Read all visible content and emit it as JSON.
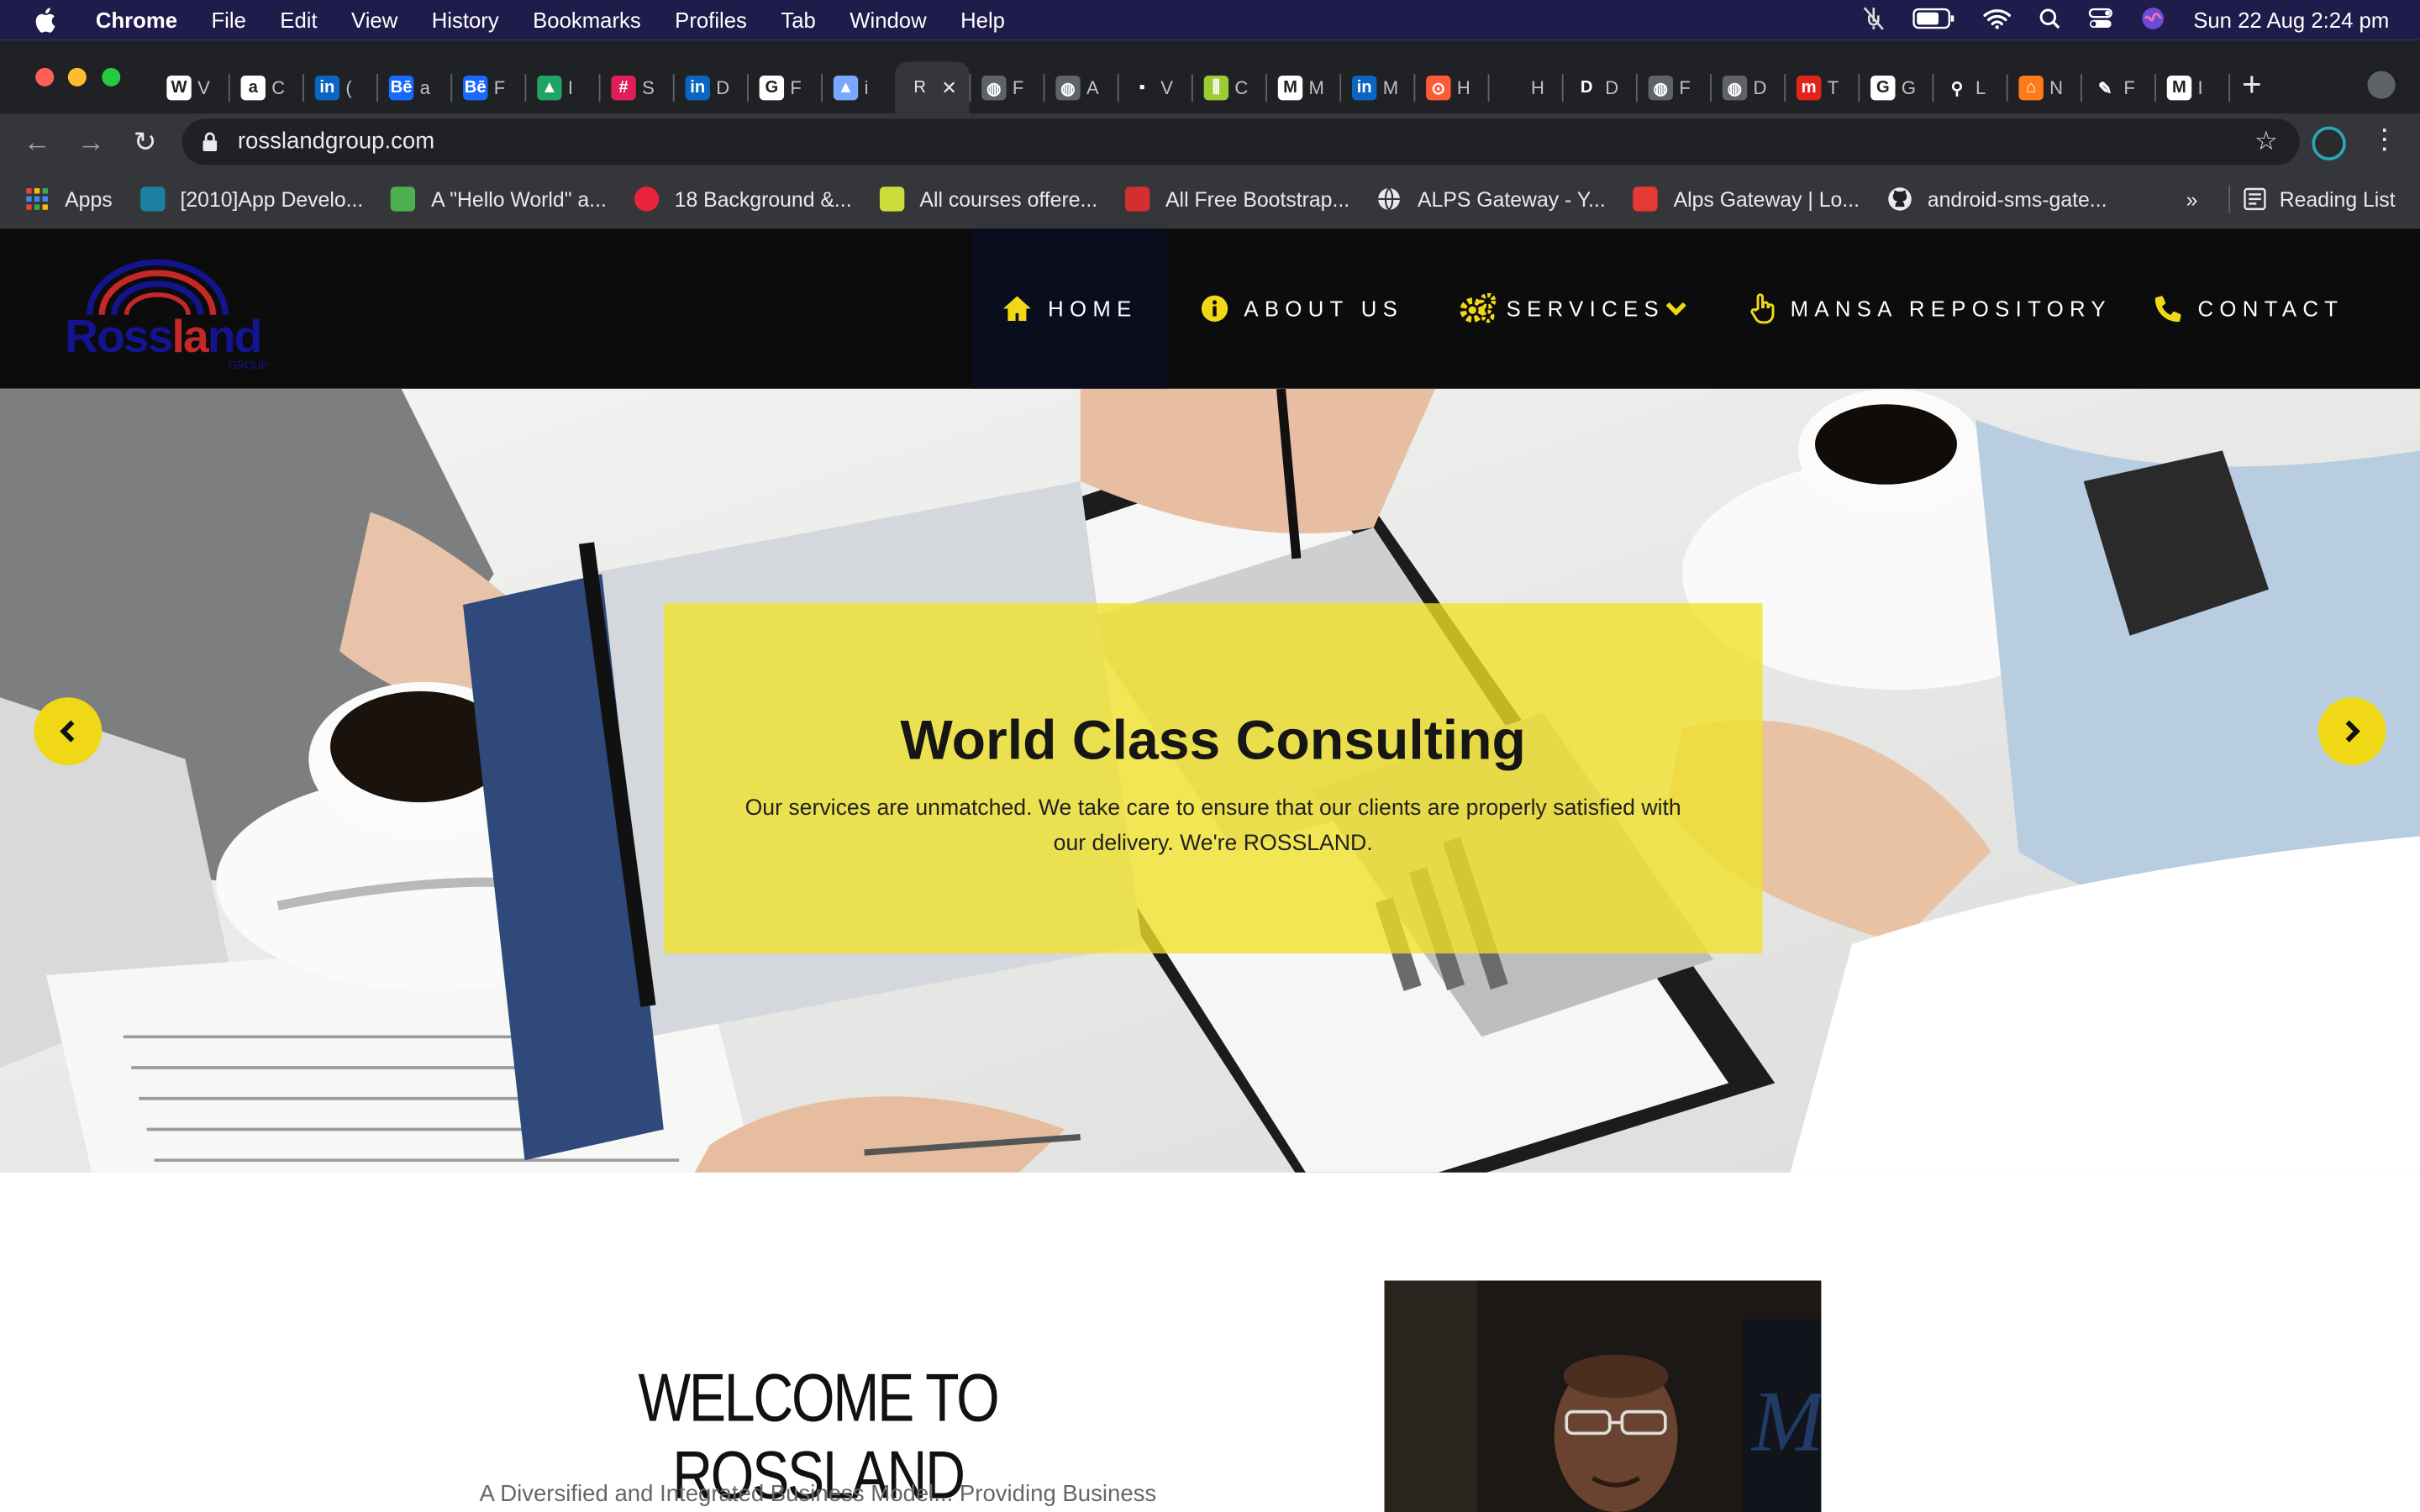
{
  "menubar": {
    "app_name": "Chrome",
    "menus": [
      "File",
      "Edit",
      "View",
      "History",
      "Bookmarks",
      "Profiles",
      "Tab",
      "Window",
      "Help"
    ],
    "clock": "Sun 22 Aug  2:24 pm"
  },
  "tabs": {
    "items": [
      {
        "icon": "wikipedia-icon",
        "glyph": "W",
        "title": "V",
        "color": "#ffffff"
      },
      {
        "icon": "amazon-icon",
        "glyph": "a",
        "title": "C",
        "color": "#ffffff"
      },
      {
        "icon": "linkedin-icon",
        "glyph": "in",
        "title": "(",
        "color": "#0a66c2"
      },
      {
        "icon": "behance-icon",
        "glyph": "Bē",
        "title": "a",
        "color": "#1769ff"
      },
      {
        "icon": "behance-icon",
        "glyph": "Bē",
        "title": "F",
        "color": "#1769ff"
      },
      {
        "icon": "google-drive-icon",
        "glyph": "▲",
        "title": "I",
        "color": "#1fa463"
      },
      {
        "icon": "slack-icon",
        "glyph": "#",
        "title": "S",
        "color": "#e01e5a"
      },
      {
        "icon": "linkedin-icon",
        "glyph": "in",
        "title": "D",
        "color": "#0a66c2"
      },
      {
        "icon": "google-icon",
        "glyph": "G",
        "title": "F",
        "color": "#ffffff"
      },
      {
        "icon": "triangle-icon",
        "glyph": "▲",
        "title": "i",
        "color": "#7aa7ff"
      },
      {
        "icon": "rossland-icon",
        "glyph": "R",
        "title": "",
        "color": "#35363a"
      },
      {
        "icon": "globe-icon",
        "glyph": "◍",
        "title": "F",
        "color": "#5f6368"
      },
      {
        "icon": "globe-icon",
        "glyph": "◍",
        "title": "A",
        "color": "#5f6368"
      },
      {
        "icon": "dark-icon",
        "glyph": "▪",
        "title": "V",
        "color": "#202124"
      },
      {
        "icon": "bars-icon",
        "glyph": "⫼",
        "title": "C",
        "color": "#9acd32"
      },
      {
        "icon": "gmail-icon",
        "glyph": "M",
        "title": "M",
        "color": "#ffffff"
      },
      {
        "icon": "linkedin-icon",
        "glyph": "in",
        "title": "M",
        "color": "#0a66c2"
      },
      {
        "icon": "hubspot-icon",
        "glyph": "⊙",
        "title": "H",
        "color": "#ff5c35"
      },
      {
        "icon": "blank-icon",
        "glyph": "",
        "title": "H",
        "color": "#202124"
      },
      {
        "icon": "dashlane-icon",
        "glyph": "D",
        "title": "D",
        "color": "#202124"
      },
      {
        "icon": "globe-icon",
        "glyph": "◍",
        "title": "F",
        "color": "#5f6368"
      },
      {
        "icon": "globe-icon",
        "glyph": "◍",
        "title": "D",
        "color": "#5f6368"
      },
      {
        "icon": "medium-m-icon",
        "glyph": "m",
        "title": "T",
        "color": "#e2231a"
      },
      {
        "icon": "google-icon",
        "glyph": "G",
        "title": "G",
        "color": "#ffffff"
      },
      {
        "icon": "pin-icon",
        "glyph": "⚲",
        "title": "L",
        "color": "#202124"
      },
      {
        "icon": "house-icon",
        "glyph": "⌂",
        "title": "N",
        "color": "#ff7a18"
      },
      {
        "icon": "pen-icon",
        "glyph": "✎",
        "title": "F",
        "color": "#202124"
      },
      {
        "icon": "gmail-icon",
        "glyph": "M",
        "title": "I",
        "color": "#ffffff"
      }
    ],
    "close_glyph": "✕",
    "new_tab_glyph": "+"
  },
  "toolbar": {
    "url": "rosslandgroup.com",
    "back_glyph": "←",
    "forward_glyph": "→",
    "reload_glyph": "↻",
    "bookmark_star": "☆",
    "menu_glyph": "⋮"
  },
  "bookmarks": {
    "items": [
      {
        "icon": "apps-grid-icon",
        "label": "Apps",
        "color": "#4285f4"
      },
      {
        "icon": "swirl-icon",
        "label": "[2010]App Develo...",
        "color": "#1a7fa0"
      },
      {
        "icon": "leaf-icon",
        "label": "A \"Hello World\" a...",
        "color": "#4caf50"
      },
      {
        "icon": "r-circle-icon",
        "label": "18 Background &...",
        "color": "#e8233b"
      },
      {
        "icon": "e-square-icon",
        "label": "All courses offere...",
        "color": "#cddc39"
      },
      {
        "icon": "s-square-icon",
        "label": "All Free Bootstrap...",
        "color": "#d32f2f"
      },
      {
        "icon": "globe-icon",
        "label": "ALPS Gateway - Y...",
        "color": "#9e9e9e"
      },
      {
        "icon": "dots-icon",
        "label": "Alps Gateway | Lo...",
        "color": "#e53935"
      },
      {
        "icon": "github-icon",
        "label": "android-sms-gate...",
        "color": "#ffffff"
      }
    ],
    "more": "»",
    "reading_list": "Reading List"
  },
  "site": {
    "logo_text_a": "Ross",
    "logo_text_b": "la",
    "logo_text_c": "nd",
    "logo_sub": "GROUP",
    "nav": [
      {
        "icon": "home-icon",
        "label": "HOME"
      },
      {
        "icon": "info-icon",
        "label": "ABOUT US"
      },
      {
        "icon": "gears-icon",
        "label": "SERVICES"
      },
      {
        "icon": "hand-pointer-icon",
        "label": "MANSA REPOSITORY"
      },
      {
        "icon": "phone-icon",
        "label": "CONTACT"
      }
    ],
    "accent": "#f0d816",
    "hero": {
      "title": "World Class Consulting",
      "subtitle": "Our services are unmatched. We take care to ensure that our clients are properly satisfied with our delivery. We're ROSSLAND."
    },
    "welcome": {
      "title": "WELCOME TO ROSSLAND",
      "subtitle": "A Diversified and Integrated Business Model... Providing Business"
    }
  }
}
